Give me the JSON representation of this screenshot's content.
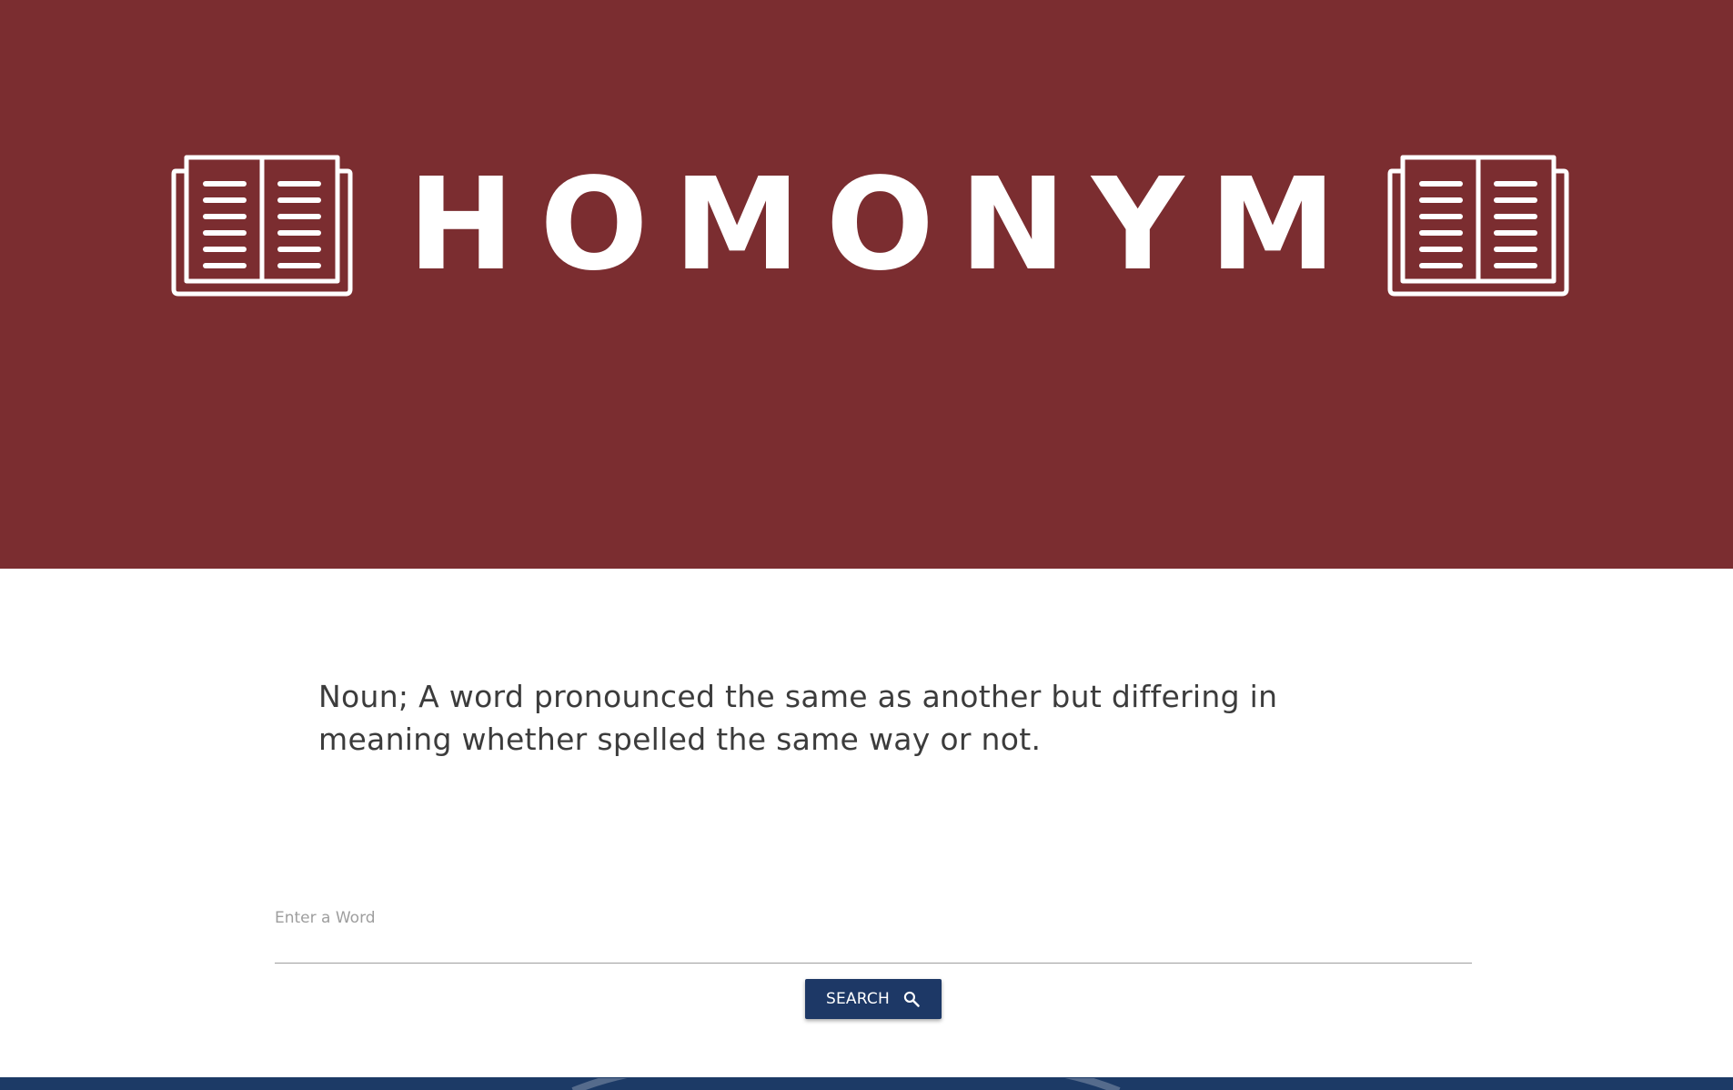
{
  "header": {
    "logo_text": "HOMONYM",
    "background_color": "#7b2d30",
    "left_icon": "open-book-icon",
    "right_icon": "open-book-icon"
  },
  "definition": {
    "text": "Noun; A word pronounced the same as another but differing in meaning whether spelled the same way or not."
  },
  "search": {
    "label": "Enter a Word",
    "value": "",
    "button_label": "Search",
    "button_icon": "search-icon",
    "button_color": "#1d3866"
  },
  "footer": {
    "background_color": "#1c3a66"
  }
}
